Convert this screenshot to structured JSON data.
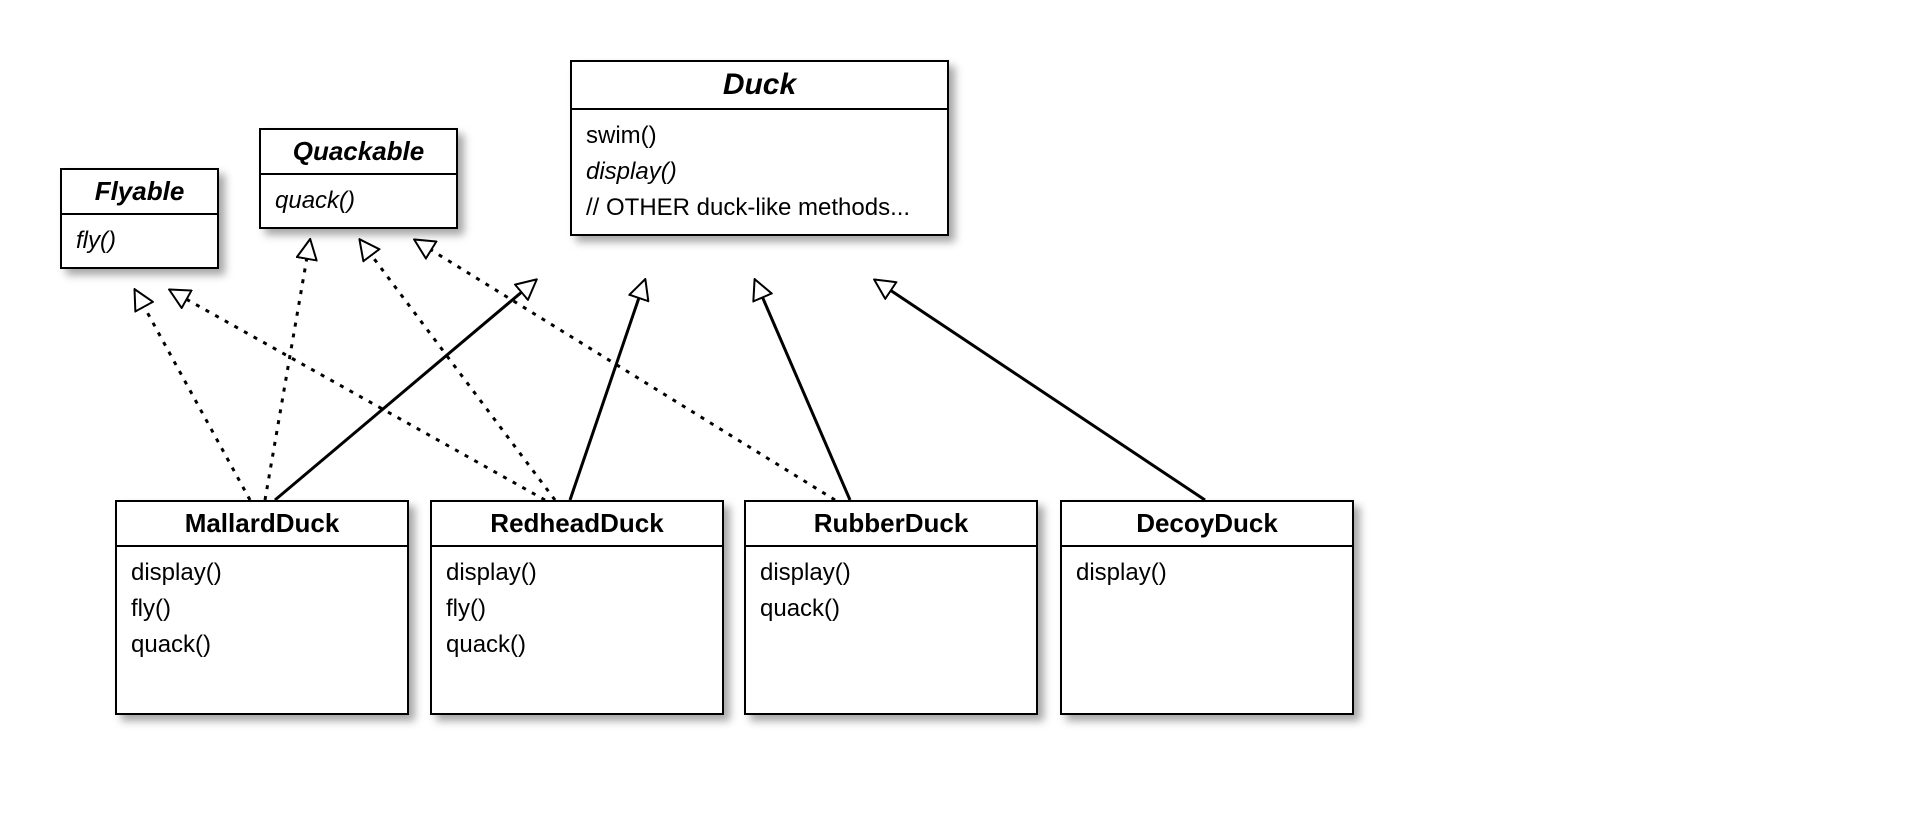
{
  "classes": {
    "flyable": {
      "name": "Flyable",
      "abstract": true,
      "methods": [
        {
          "sig": "fly()",
          "abstract": true
        }
      ]
    },
    "quackable": {
      "name": "Quackable",
      "abstract": true,
      "methods": [
        {
          "sig": "quack()",
          "abstract": true
        }
      ]
    },
    "duck": {
      "name": "Duck",
      "abstract": true,
      "methods": [
        {
          "sig": "swim()",
          "abstract": false
        },
        {
          "sig": "display()",
          "abstract": true
        },
        {
          "sig": "// OTHER duck-like methods...",
          "abstract": false
        }
      ]
    },
    "mallard": {
      "name": "MallardDuck",
      "abstract": false,
      "methods": [
        {
          "sig": "display()",
          "abstract": false
        },
        {
          "sig": "fly()",
          "abstract": false
        },
        {
          "sig": "quack()",
          "abstract": false
        }
      ]
    },
    "redhead": {
      "name": "RedheadDuck",
      "abstract": false,
      "methods": [
        {
          "sig": "display()",
          "abstract": false
        },
        {
          "sig": "fly()",
          "abstract": false
        },
        {
          "sig": "quack()",
          "abstract": false
        }
      ]
    },
    "rubber": {
      "name": "RubberDuck",
      "abstract": false,
      "methods": [
        {
          "sig": "display()",
          "abstract": false
        },
        {
          "sig": "quack()",
          "abstract": false
        }
      ]
    },
    "decoy": {
      "name": "DecoyDuck",
      "abstract": false,
      "methods": [
        {
          "sig": "display()",
          "abstract": false
        }
      ]
    }
  },
  "relations": [
    {
      "from": "mallard",
      "to": "duck",
      "type": "extends"
    },
    {
      "from": "redhead",
      "to": "duck",
      "type": "extends"
    },
    {
      "from": "rubber",
      "to": "duck",
      "type": "extends"
    },
    {
      "from": "decoy",
      "to": "duck",
      "type": "extends"
    },
    {
      "from": "mallard",
      "to": "flyable",
      "type": "implements"
    },
    {
      "from": "mallard",
      "to": "quackable",
      "type": "implements"
    },
    {
      "from": "redhead",
      "to": "flyable",
      "type": "implements"
    },
    {
      "from": "redhead",
      "to": "quackable",
      "type": "implements"
    },
    {
      "from": "rubber",
      "to": "quackable",
      "type": "implements"
    }
  ]
}
